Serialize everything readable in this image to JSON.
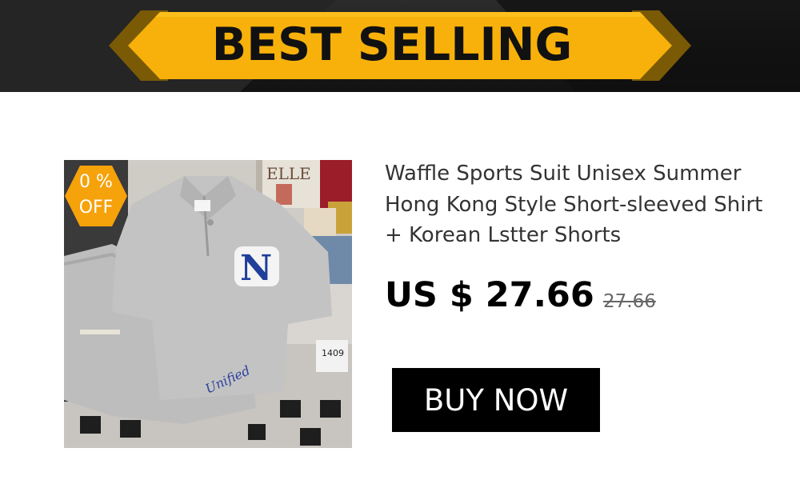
{
  "banner": {
    "text": "BEST SELLING"
  },
  "badge": {
    "percent_line": "0  %",
    "off_label": "OFF"
  },
  "product": {
    "title": "Waffle Sports Suit Unisex Summer Hong Kong Style Short-sleeved Shirt + Korean Lstter Shorts",
    "price": "US $ 27.66",
    "original_price": "27.66",
    "image_text": {
      "magazine": "ELLE",
      "tag": "1409"
    }
  },
  "cta": {
    "label": "BUY NOW"
  },
  "colors": {
    "banner_gold": "#F7B10A",
    "banner_dark": "#1a1a1a",
    "badge_orange": "#F5A20B",
    "button_bg": "#000000"
  },
  "icons": {
    "badge_shape": "hexagon"
  }
}
